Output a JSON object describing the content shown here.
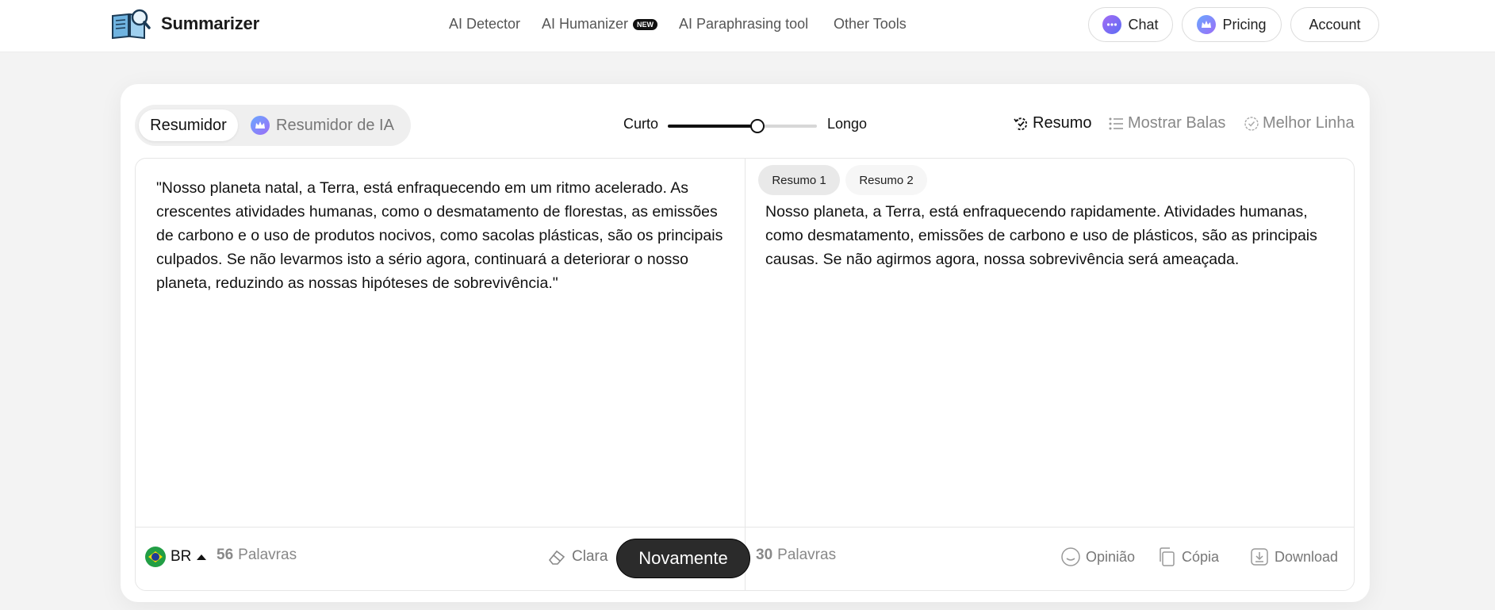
{
  "header": {
    "brand": "Summarizer",
    "nav": [
      {
        "label": "AI Detector"
      },
      {
        "label": "AI Humanizer",
        "badge": "NEW"
      },
      {
        "label": "AI Paraphrasing tool"
      },
      {
        "label": "Other Tools"
      }
    ],
    "chat_label": "Chat",
    "pricing_label": "Pricing",
    "account_label": "Account"
  },
  "toolbar": {
    "mode_active": "Resumidor",
    "mode_ai": "Resumidor de IA",
    "length_short": "Curto",
    "length_long": "Longo",
    "length_level": 0.6,
    "view_summary": "Resumo",
    "view_bullets": "Mostrar Balas",
    "view_best_line": "Melhor Linha"
  },
  "input": {
    "text": "\"Nosso planeta natal, a Terra, está enfraquecendo em um ritmo acelerado. As crescentes atividades humanas, como o desmatamento de florestas, as emissões de carbono e o uso de produtos nocivos, como sacolas plásticas, são os principais culpados. Se não levarmos isto a sério agora, continuará a deteriorar o nosso planeta, reduzindo as nossas hipóteses de sobrevivência.\"",
    "language": "BR",
    "word_count": "56",
    "words_label": "Palavras",
    "clear_label": "Clara",
    "again_label": "Novamente"
  },
  "output": {
    "tabs": [
      "Resumo 1",
      "Resumo 2"
    ],
    "text": "Nosso planeta, a Terra, está enfraquecendo rapidamente. Atividades humanas, como desmatamento, emissões de carbono e uso de plásticos, são as principais causas. Se não agirmos agora, nossa sobrevivência será ameaçada.",
    "word_count": "30",
    "words_label": "Palavras",
    "feedback_label": "Opinião",
    "copy_label": "Cópia",
    "download_label": "Download"
  },
  "colors": {
    "accent_dark": "#2b2b2b",
    "chat_icon": "#7b5cf5",
    "pricing_icon": "#4f8ff7"
  }
}
